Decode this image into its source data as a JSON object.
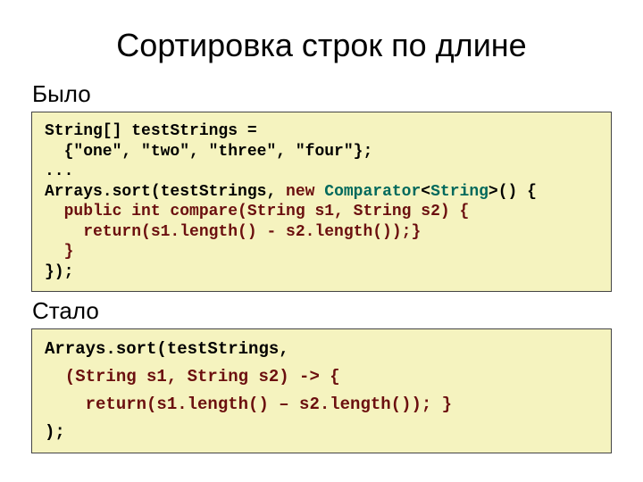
{
  "title": "Сортировка строк по длине",
  "before_label": "Было",
  "after_label": "Стало",
  "code_before": {
    "l1": "String[] testStrings =",
    "l2": "  {\"one\", \"two\", \"three\", \"four\"};",
    "l3": "...",
    "l4a": "Arrays.sort(testStrings, ",
    "l4b": "new ",
    "l4c": "Comparator",
    "l4d": "<",
    "l4e": "String",
    "l4f": ">",
    "l4g": "() {",
    "l5": "  public int compare(String s1, String s2) {",
    "l6": "    return(s1.length() - s2.length());}",
    "l7": "  }",
    "l8": "});"
  },
  "code_after": {
    "l1": "Arrays.sort(testStrings,",
    "l2": "  (String s1, String s2) -> {",
    "l3": "    return(s1.length() – s2.length()); }",
    "l4": ");"
  }
}
